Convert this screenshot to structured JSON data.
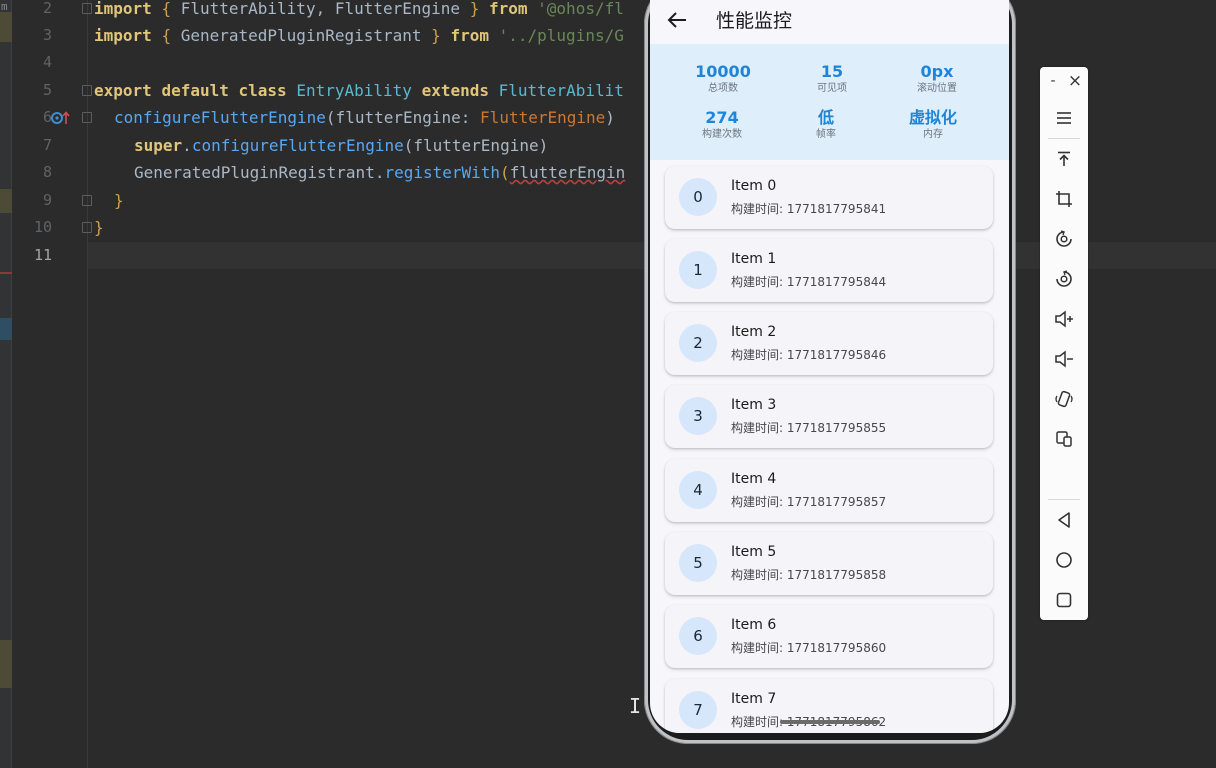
{
  "editor": {
    "line_numbers": [
      "2",
      "3",
      "4",
      "5",
      "6",
      "7",
      "8",
      "9",
      "10",
      "11"
    ],
    "left_strip_char": "m",
    "lines": {
      "l2": {
        "kw": "import",
        "brace_open": "{",
        "names": " FlutterAbility, FlutterEngine ",
        "brace_close": "}",
        "from": "from",
        "path": "'@ohos/fl"
      },
      "l3": {
        "kw": "import",
        "brace_open": "{",
        "names": " GeneratedPluginRegistrant ",
        "brace_close": "}",
        "from": "from",
        "path": "'../plugins/G"
      },
      "l5": {
        "export": "export",
        "default": "default",
        "class": "class",
        "name": "EntryAbility",
        "extends": "extends",
        "parent": "FlutterAbilit"
      },
      "l6": {
        "method": "configureFlutterEngine",
        "param": "(flutterEngine: ",
        "type": "FlutterEngine",
        "close": ")"
      },
      "l7": {
        "super": "super",
        "call": "configureFlutterEngine",
        "args": "(flutterEngine)"
      },
      "l8": {
        "obj": "GeneratedPluginRegistrant.",
        "call": "registerWith",
        "open": "(",
        "arg": "flutterEngin"
      },
      "l9": {
        "brace": "}"
      },
      "l10": {
        "brace": "}"
      }
    },
    "cursor_glyph": "I"
  },
  "phone": {
    "title": "性能监控",
    "stats": [
      {
        "value": "10000",
        "label": "总项数"
      },
      {
        "value": "15",
        "label": "可见项"
      },
      {
        "value": "0px",
        "label": "滚动位置"
      },
      {
        "value": "274",
        "label": "构建次数"
      },
      {
        "value": "低",
        "label": "帧率"
      },
      {
        "value": "虚拟化",
        "label": "内存"
      }
    ],
    "items": [
      {
        "index": "0",
        "title": "Item 0",
        "subtitle": "构建时间: 1771817795841"
      },
      {
        "index": "1",
        "title": "Item 1",
        "subtitle": "构建时间: 1771817795844"
      },
      {
        "index": "2",
        "title": "Item 2",
        "subtitle": "构建时间: 1771817795846"
      },
      {
        "index": "3",
        "title": "Item 3",
        "subtitle": "构建时间: 1771817795855"
      },
      {
        "index": "4",
        "title": "Item 4",
        "subtitle": "构建时间: 1771817795857"
      },
      {
        "index": "5",
        "title": "Item 5",
        "subtitle": "构建时间: 1771817795858"
      },
      {
        "index": "6",
        "title": "Item 6",
        "subtitle": "构建时间: 1771817795860"
      },
      {
        "index": "7",
        "title": "Item 7",
        "subtitle": "构建时间: 1771817795862"
      }
    ]
  },
  "emulator_toolbar": {
    "top": {
      "minimize": "-",
      "close": "×"
    },
    "buttons": [
      "menu-icon",
      "pin-to-top-icon",
      "screenshot-crop-icon",
      "rotate-left-icon",
      "rotate-right-icon",
      "volume-up-icon",
      "volume-down-icon",
      "shake-icon",
      "multi-device-icon",
      "back-nav-icon",
      "home-nav-icon",
      "recents-nav-icon"
    ]
  },
  "colors": {
    "accent": "#1f85d8",
    "stats_bg": "#deeefb",
    "avatar_bg": "#d6e6fb",
    "editor_bg": "#2b2b2b"
  }
}
